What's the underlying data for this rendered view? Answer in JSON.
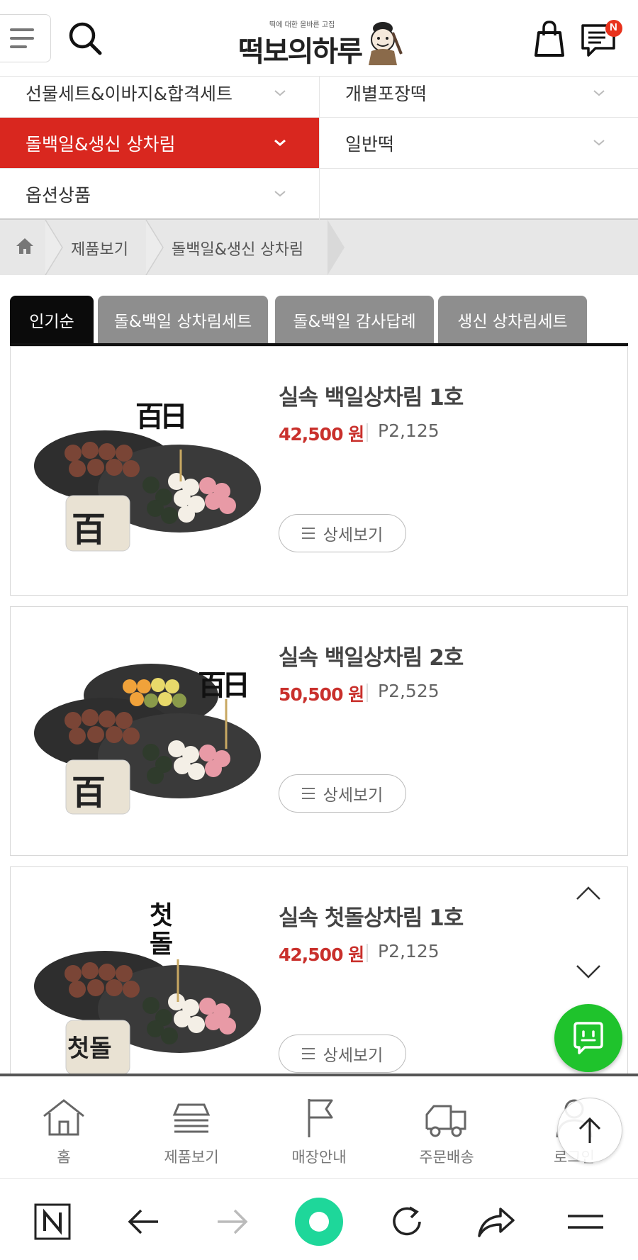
{
  "header": {
    "logo_tagline": "떡에 대한 올바른 고집",
    "logo_text": "떡보의하루",
    "badge": "N"
  },
  "categories": [
    {
      "label": "선물세트&이바지&합격세트"
    },
    {
      "label": "개별포장떡"
    },
    {
      "label": "돌백일&생신 상차림"
    },
    {
      "label": "일반떡"
    },
    {
      "label": "옵션상품"
    }
  ],
  "breadcrumb": {
    "items": [
      "제품보기",
      "돌백일&생신 상차림"
    ]
  },
  "tabs": [
    {
      "label": "인기순"
    },
    {
      "label": "돌&백일 상차림세트"
    },
    {
      "label": "돌&백일 감사답례"
    },
    {
      "label": "생신 상차림세트"
    }
  ],
  "products": [
    {
      "name": "실속 백일상차림 1호",
      "price": "42,500 원",
      "point": "P2,125",
      "detail_label": "상세보기",
      "sign": "百日",
      "stamp": "百"
    },
    {
      "name": "실속 백일상차림 2호",
      "price": "50,500 원",
      "point": "P2,525",
      "detail_label": "상세보기",
      "sign": "百日",
      "stamp": "百"
    },
    {
      "name": "실속 첫돌상차림 1호",
      "price": "42,500 원",
      "point": "P2,125",
      "detail_label": "상세보기",
      "sign": "첫돌",
      "stamp": "첫돌"
    }
  ],
  "site_nav": [
    {
      "label": "홈",
      "icon": "home-icon"
    },
    {
      "label": "제품보기",
      "icon": "stack-icon"
    },
    {
      "label": "매장안내",
      "icon": "flag-icon"
    },
    {
      "label": "주문배송",
      "icon": "truck-icon"
    },
    {
      "label": "로그인",
      "icon": "user-icon"
    }
  ],
  "colors": {
    "accent": "#d9271f",
    "price": "#c9302c",
    "chat": "#1fc32c",
    "browser_accent": "#1ed79a"
  }
}
